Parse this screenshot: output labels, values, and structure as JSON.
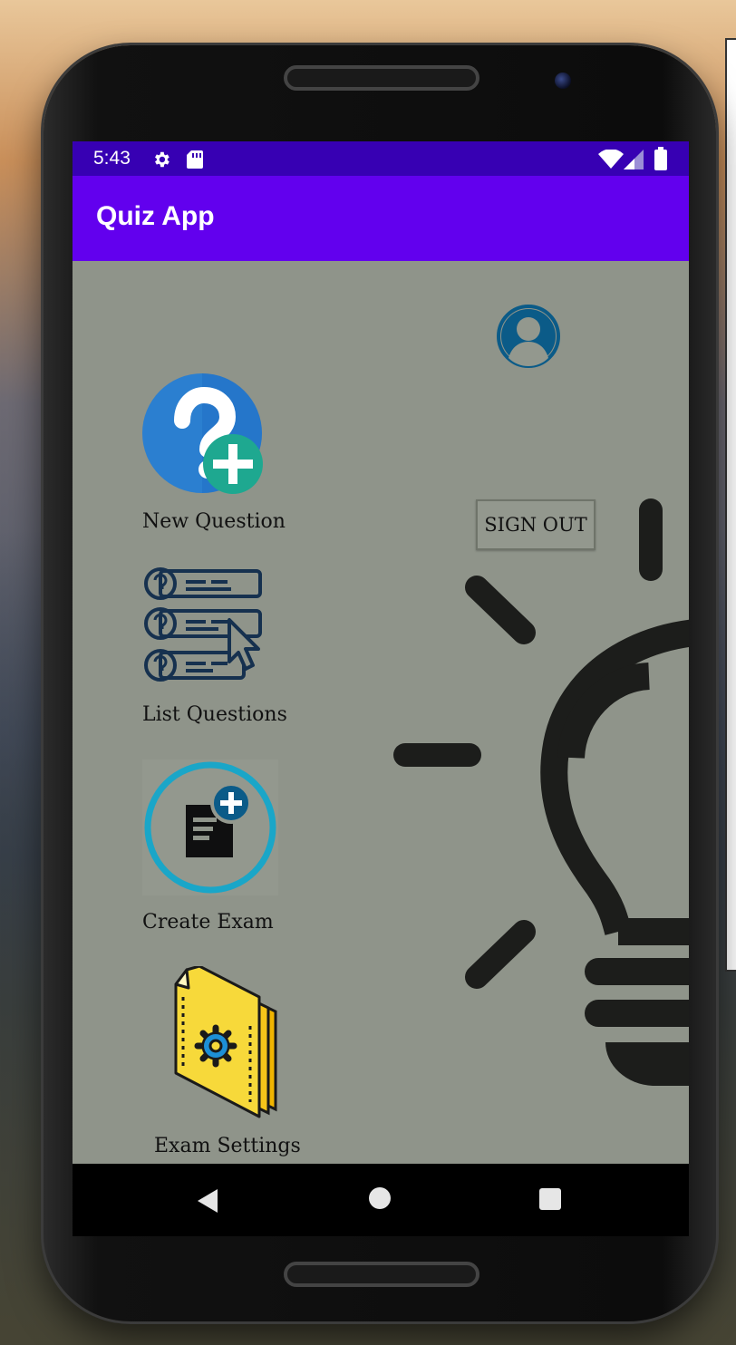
{
  "status_bar": {
    "time": "5:43",
    "icons": [
      "gear-icon",
      "sd-card-icon",
      "wifi-icon",
      "signal-icon",
      "battery-icon"
    ]
  },
  "app_bar": {
    "title": "Quiz App"
  },
  "user": {
    "avatar_icon": "user-avatar-icon",
    "sign_out_label": "SIGN OUT"
  },
  "menu": {
    "items": [
      {
        "label": "New Question",
        "icon": "question-add-icon"
      },
      {
        "label": "List Questions",
        "icon": "question-list-icon"
      },
      {
        "label": "Create Exam",
        "icon": "create-exam-icon"
      },
      {
        "label": "Exam Settings",
        "icon": "exam-settings-icon"
      }
    ]
  },
  "background": {
    "icon": "lightbulb-icon"
  },
  "nav_bar": {
    "buttons": [
      "back-icon",
      "home-icon",
      "recents-icon"
    ]
  },
  "colors": {
    "status_bar": "#3700b3",
    "app_bar": "#6200ee",
    "screen_background": "#8f948a"
  }
}
